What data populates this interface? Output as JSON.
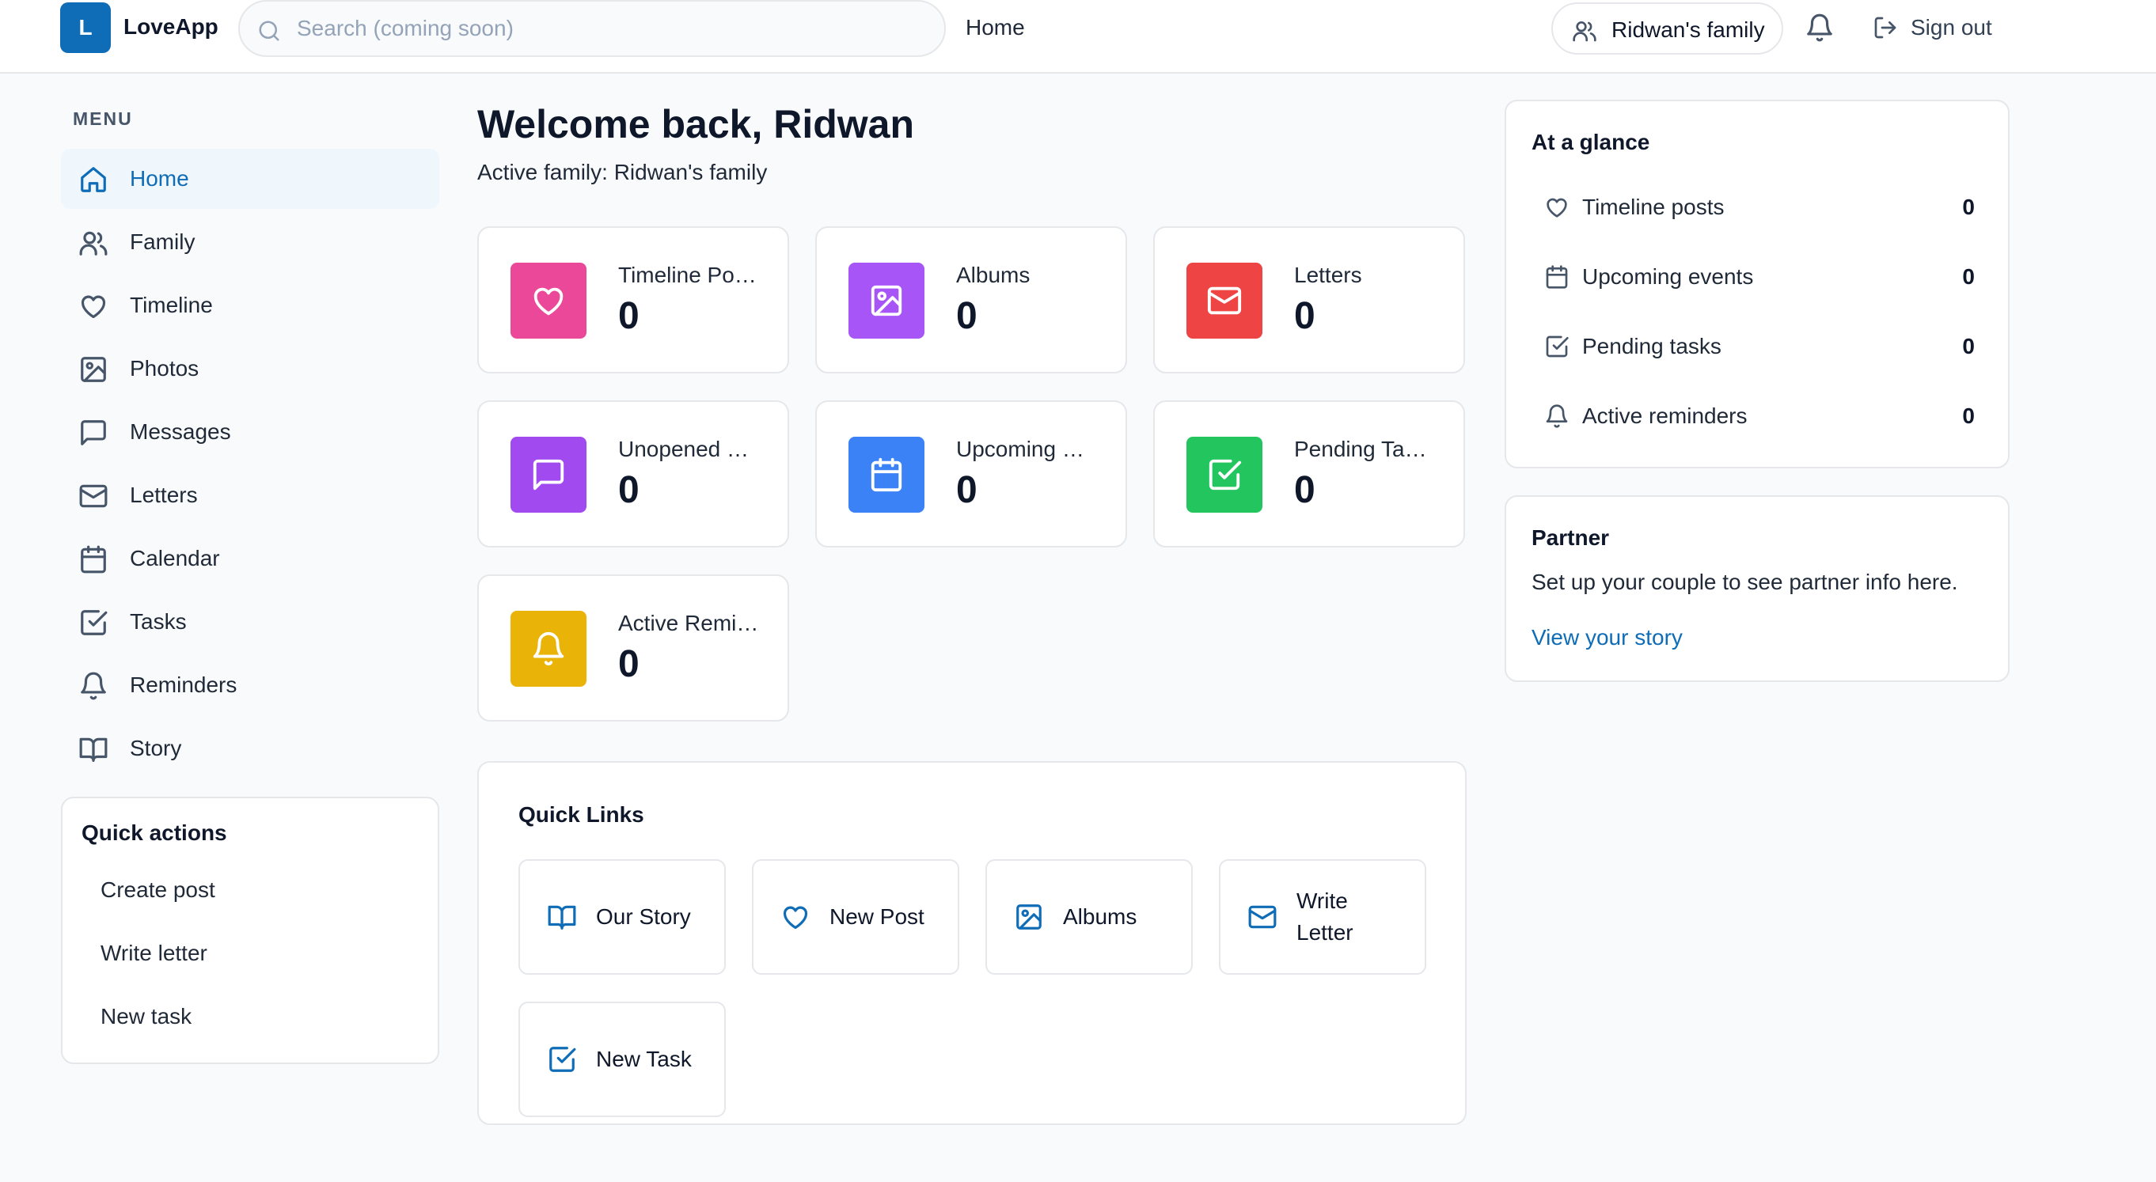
{
  "colors": {
    "brand": "#0f6cb6",
    "pink": "#ec4899",
    "purple": "#a855f7",
    "violet": "#a14af0",
    "red": "#ef4444",
    "blue": "#3b82f6",
    "green": "#22c55e",
    "yellow": "#eab308"
  },
  "header": {
    "logo_letter": "L",
    "app_name": "LoveApp",
    "search_placeholder": "Search (coming soon)",
    "home_link": "Home",
    "family_label": "Ridwan's family",
    "signout_label": "Sign out"
  },
  "sidebar": {
    "heading": "MENU",
    "items": [
      {
        "label": "Home",
        "icon": "home-icon",
        "active": true
      },
      {
        "label": "Family",
        "icon": "users-icon"
      },
      {
        "label": "Timeline",
        "icon": "heart-icon"
      },
      {
        "label": "Photos",
        "icon": "image-icon"
      },
      {
        "label": "Messages",
        "icon": "message-icon"
      },
      {
        "label": "Letters",
        "icon": "mail-icon"
      },
      {
        "label": "Calendar",
        "icon": "calendar-icon"
      },
      {
        "label": "Tasks",
        "icon": "check-square-icon"
      },
      {
        "label": "Reminders",
        "icon": "bell-icon"
      },
      {
        "label": "Story",
        "icon": "book-icon"
      }
    ],
    "quick_actions": {
      "title": "Quick actions",
      "items": [
        "Create post",
        "Write letter",
        "New task"
      ]
    }
  },
  "main": {
    "welcome": "Welcome back, Ridwan",
    "active_family": "Active family: Ridwan's family",
    "stats": [
      {
        "label": "Timeline Posts",
        "value": "0",
        "icon": "heart-icon"
      },
      {
        "label": "Albums",
        "value": "0",
        "icon": "image-icon"
      },
      {
        "label": "Letters",
        "value": "0",
        "icon": "mail-icon"
      },
      {
        "label": "Unopened Messages",
        "value": "0",
        "icon": "message-icon"
      },
      {
        "label": "Upcoming Events",
        "value": "0",
        "icon": "calendar-icon"
      },
      {
        "label": "Pending Tasks",
        "value": "0",
        "icon": "check-square-icon"
      },
      {
        "label": "Active Reminders",
        "value": "0",
        "icon": "bell-icon"
      }
    ],
    "quick_links": {
      "title": "Quick Links",
      "items": [
        {
          "label": "Our Story",
          "icon": "book-icon"
        },
        {
          "label": "New Post",
          "icon": "heart-icon"
        },
        {
          "label": "Albums",
          "icon": "image-icon"
        },
        {
          "label": "Write Letter",
          "icon": "mail-icon"
        },
        {
          "label": "New Task",
          "icon": "check-square-icon"
        }
      ]
    }
  },
  "right": {
    "glance": {
      "title": "At a glance",
      "rows": [
        {
          "label": "Timeline posts",
          "value": "0",
          "icon": "heart-icon"
        },
        {
          "label": "Upcoming events",
          "value": "0",
          "icon": "calendar-icon"
        },
        {
          "label": "Pending tasks",
          "value": "0",
          "icon": "check-square-icon"
        },
        {
          "label": "Active reminders",
          "value": "0",
          "icon": "bell-icon"
        }
      ]
    },
    "partner": {
      "title": "Partner",
      "text": "Set up your couple to see partner info here.",
      "link": "View your story"
    }
  }
}
